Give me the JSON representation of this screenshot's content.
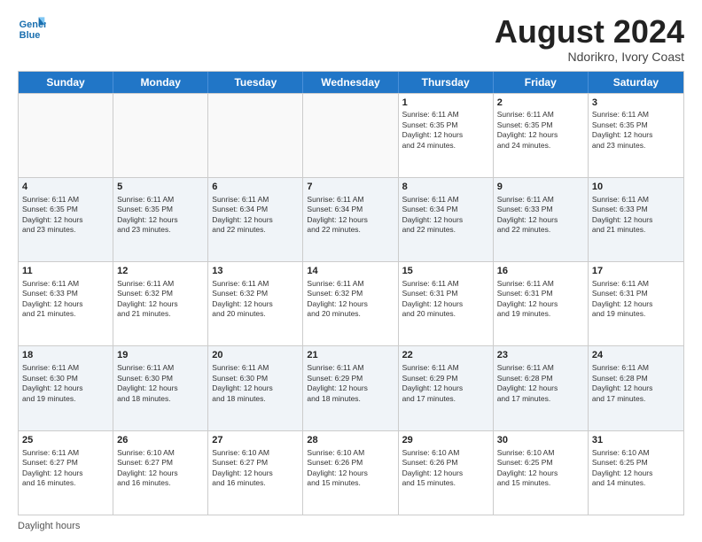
{
  "logo": {
    "line1": "General",
    "line2": "Blue"
  },
  "title": {
    "month": "August 2024",
    "location": "Ndorikro, Ivory Coast"
  },
  "header_days": [
    "Sunday",
    "Monday",
    "Tuesday",
    "Wednesday",
    "Thursday",
    "Friday",
    "Saturday"
  ],
  "footer": {
    "label": "Daylight hours"
  },
  "weeks": [
    [
      {
        "day": "",
        "info": ""
      },
      {
        "day": "",
        "info": ""
      },
      {
        "day": "",
        "info": ""
      },
      {
        "day": "",
        "info": ""
      },
      {
        "day": "1",
        "info": "Sunrise: 6:11 AM\nSunset: 6:35 PM\nDaylight: 12 hours\nand 24 minutes."
      },
      {
        "day": "2",
        "info": "Sunrise: 6:11 AM\nSunset: 6:35 PM\nDaylight: 12 hours\nand 24 minutes."
      },
      {
        "day": "3",
        "info": "Sunrise: 6:11 AM\nSunset: 6:35 PM\nDaylight: 12 hours\nand 23 minutes."
      }
    ],
    [
      {
        "day": "4",
        "info": "Sunrise: 6:11 AM\nSunset: 6:35 PM\nDaylight: 12 hours\nand 23 minutes."
      },
      {
        "day": "5",
        "info": "Sunrise: 6:11 AM\nSunset: 6:35 PM\nDaylight: 12 hours\nand 23 minutes."
      },
      {
        "day": "6",
        "info": "Sunrise: 6:11 AM\nSunset: 6:34 PM\nDaylight: 12 hours\nand 22 minutes."
      },
      {
        "day": "7",
        "info": "Sunrise: 6:11 AM\nSunset: 6:34 PM\nDaylight: 12 hours\nand 22 minutes."
      },
      {
        "day": "8",
        "info": "Sunrise: 6:11 AM\nSunset: 6:34 PM\nDaylight: 12 hours\nand 22 minutes."
      },
      {
        "day": "9",
        "info": "Sunrise: 6:11 AM\nSunset: 6:33 PM\nDaylight: 12 hours\nand 22 minutes."
      },
      {
        "day": "10",
        "info": "Sunrise: 6:11 AM\nSunset: 6:33 PM\nDaylight: 12 hours\nand 21 minutes."
      }
    ],
    [
      {
        "day": "11",
        "info": "Sunrise: 6:11 AM\nSunset: 6:33 PM\nDaylight: 12 hours\nand 21 minutes."
      },
      {
        "day": "12",
        "info": "Sunrise: 6:11 AM\nSunset: 6:32 PM\nDaylight: 12 hours\nand 21 minutes."
      },
      {
        "day": "13",
        "info": "Sunrise: 6:11 AM\nSunset: 6:32 PM\nDaylight: 12 hours\nand 20 minutes."
      },
      {
        "day": "14",
        "info": "Sunrise: 6:11 AM\nSunset: 6:32 PM\nDaylight: 12 hours\nand 20 minutes."
      },
      {
        "day": "15",
        "info": "Sunrise: 6:11 AM\nSunset: 6:31 PM\nDaylight: 12 hours\nand 20 minutes."
      },
      {
        "day": "16",
        "info": "Sunrise: 6:11 AM\nSunset: 6:31 PM\nDaylight: 12 hours\nand 19 minutes."
      },
      {
        "day": "17",
        "info": "Sunrise: 6:11 AM\nSunset: 6:31 PM\nDaylight: 12 hours\nand 19 minutes."
      }
    ],
    [
      {
        "day": "18",
        "info": "Sunrise: 6:11 AM\nSunset: 6:30 PM\nDaylight: 12 hours\nand 19 minutes."
      },
      {
        "day": "19",
        "info": "Sunrise: 6:11 AM\nSunset: 6:30 PM\nDaylight: 12 hours\nand 18 minutes."
      },
      {
        "day": "20",
        "info": "Sunrise: 6:11 AM\nSunset: 6:30 PM\nDaylight: 12 hours\nand 18 minutes."
      },
      {
        "day": "21",
        "info": "Sunrise: 6:11 AM\nSunset: 6:29 PM\nDaylight: 12 hours\nand 18 minutes."
      },
      {
        "day": "22",
        "info": "Sunrise: 6:11 AM\nSunset: 6:29 PM\nDaylight: 12 hours\nand 17 minutes."
      },
      {
        "day": "23",
        "info": "Sunrise: 6:11 AM\nSunset: 6:28 PM\nDaylight: 12 hours\nand 17 minutes."
      },
      {
        "day": "24",
        "info": "Sunrise: 6:11 AM\nSunset: 6:28 PM\nDaylight: 12 hours\nand 17 minutes."
      }
    ],
    [
      {
        "day": "25",
        "info": "Sunrise: 6:11 AM\nSunset: 6:27 PM\nDaylight: 12 hours\nand 16 minutes."
      },
      {
        "day": "26",
        "info": "Sunrise: 6:10 AM\nSunset: 6:27 PM\nDaylight: 12 hours\nand 16 minutes."
      },
      {
        "day": "27",
        "info": "Sunrise: 6:10 AM\nSunset: 6:27 PM\nDaylight: 12 hours\nand 16 minutes."
      },
      {
        "day": "28",
        "info": "Sunrise: 6:10 AM\nSunset: 6:26 PM\nDaylight: 12 hours\nand 15 minutes."
      },
      {
        "day": "29",
        "info": "Sunrise: 6:10 AM\nSunset: 6:26 PM\nDaylight: 12 hours\nand 15 minutes."
      },
      {
        "day": "30",
        "info": "Sunrise: 6:10 AM\nSunset: 6:25 PM\nDaylight: 12 hours\nand 15 minutes."
      },
      {
        "day": "31",
        "info": "Sunrise: 6:10 AM\nSunset: 6:25 PM\nDaylight: 12 hours\nand 14 minutes."
      }
    ]
  ]
}
